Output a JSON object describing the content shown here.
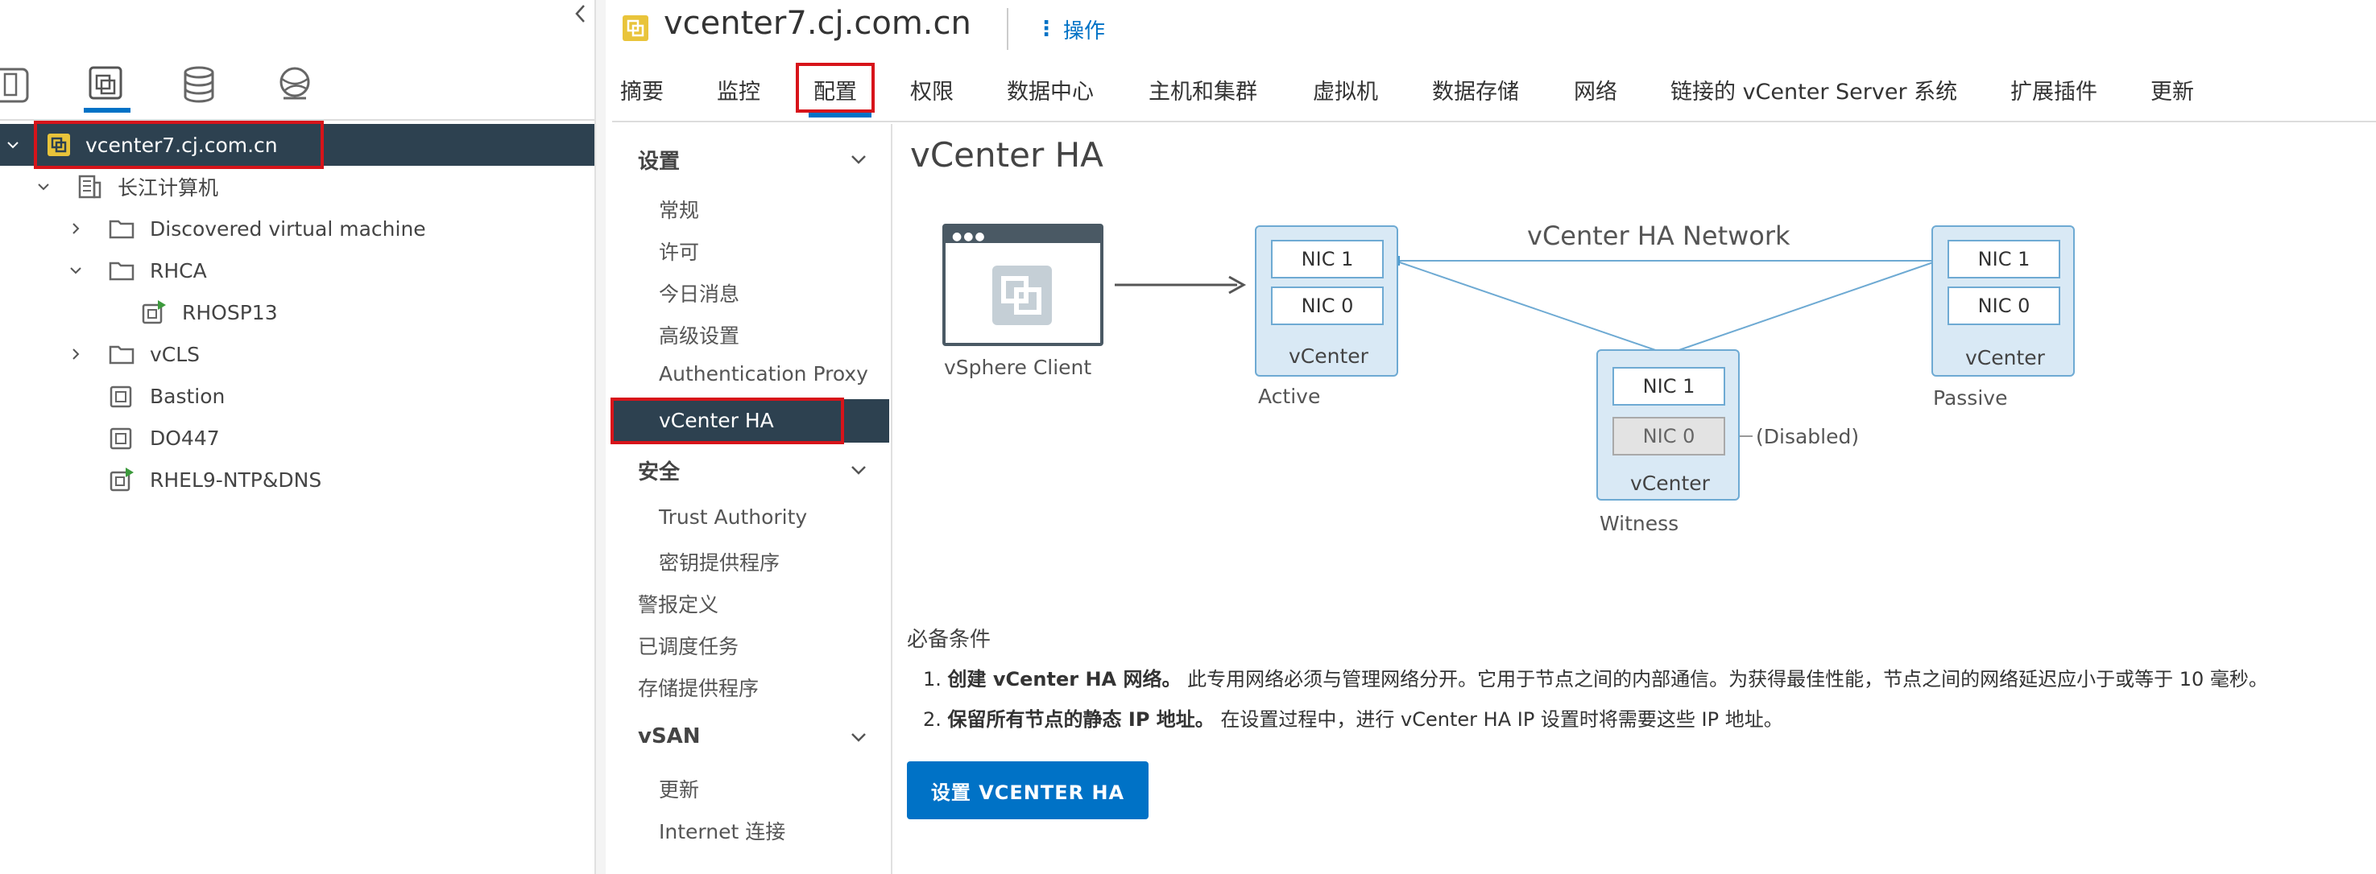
{
  "left_pane": {
    "collapse_icon": "chevron-left-icon",
    "view_icons": [
      "hosts-clusters-icon",
      "vms-templates-icon",
      "storage-icon",
      "networking-icon"
    ],
    "tree": [
      {
        "label": "vcenter7.cj.com.cn",
        "icon": "vcenter-icon",
        "expanded": true,
        "selected": true
      },
      {
        "label": "长江计算机",
        "icon": "datacenter-icon",
        "expanded": true
      },
      {
        "label": "Discovered virtual machine",
        "icon": "folder-icon",
        "expanded": false
      },
      {
        "label": "RHCA",
        "icon": "folder-icon",
        "expanded": true
      },
      {
        "label": "RHOSP13",
        "icon": "vm-powered-on-icon"
      },
      {
        "label": "vCLS",
        "icon": "folder-icon",
        "expanded": false
      },
      {
        "label": "Bastion",
        "icon": "vm-icon"
      },
      {
        "label": "DO447",
        "icon": "vm-icon"
      },
      {
        "label": "RHEL9-NTP&DNS",
        "icon": "vm-powered-on-icon"
      }
    ]
  },
  "header": {
    "title": "vcenter7.cj.com.cn",
    "actions_label": "操作",
    "tabs": [
      "摘要",
      "监控",
      "配置",
      "权限",
      "数据中心",
      "主机和集群",
      "虚拟机",
      "数据存储",
      "网络",
      "链接的 vCenter Server 系统",
      "扩展插件",
      "更新"
    ],
    "active_tab": "配置"
  },
  "sidebar": {
    "sections": [
      {
        "title": "设置",
        "items": [
          "常规",
          "许可",
          "今日消息",
          "高级设置",
          "Authentication Proxy",
          "vCenter HA"
        ]
      },
      {
        "title": "安全",
        "items": [
          "Trust Authority",
          "密钥提供程序"
        ]
      },
      {
        "title": "",
        "items": [
          "警报定义",
          "已调度任务",
          "存储提供程序"
        ]
      },
      {
        "title": "vSAN",
        "items": [
          "更新",
          "Internet 连接"
        ]
      }
    ],
    "selected_item": "vCenter HA"
  },
  "content": {
    "page_title": "vCenter HA",
    "diagram": {
      "network_label": "vCenter HA Network",
      "client_label": "vSphere Client",
      "active": {
        "nic1": "NIC 1",
        "nic0": "NIC 0",
        "box_label": "vCenter",
        "role": "Active"
      },
      "passive": {
        "nic1": "NIC 1",
        "nic0": "NIC 0",
        "box_label": "vCenter",
        "role": "Passive"
      },
      "witness": {
        "nic1": "NIC 1",
        "nic0": "NIC 0",
        "box_label": "vCenter",
        "role": "Witness",
        "nic0_note": "(Disabled)"
      }
    },
    "prereq_title": "必备条件",
    "prereq_items": [
      {
        "num": "1.",
        "bold": "创建 vCenter HA 网络。",
        "text": " 此专用网络必须与管理网络分开。它用于节点之间的内部通信。为获得最佳性能，节点之间的网络延迟应小于或等于 10 毫秒。"
      },
      {
        "num": "2.",
        "bold": "保留所有节点的静态 IP 地址。",
        "text": " 在设置过程中，进行 vCenter HA IP 设置时将需要这些 IP 地址。"
      }
    ],
    "setup_button": "设置 VCENTER HA"
  },
  "colors": {
    "accent": "#0072c6",
    "selected_row": "#2d4150",
    "highlight_box": "#d7141a",
    "diagram_line": "#6eaad3",
    "diagram_fill": "#d9e9f5"
  }
}
